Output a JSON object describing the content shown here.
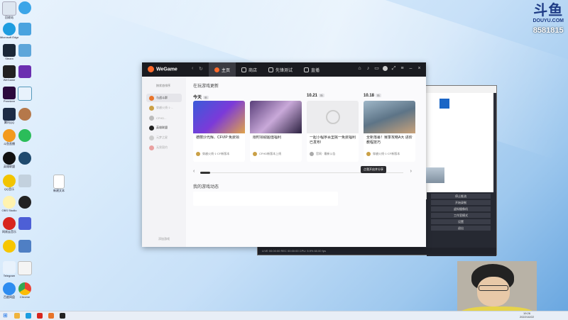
{
  "watermark": {
    "logo": "斗鱼",
    "site": "DOUYU.COM",
    "room": "8581815"
  },
  "app": {
    "brand": "WeGame",
    "tabs": [
      {
        "label": "主页"
      },
      {
        "label": "商店"
      },
      {
        "label": "先锋测试"
      },
      {
        "label": "直播"
      }
    ],
    "sidebar": {
      "sort_label": "按状态排序",
      "items": [
        {
          "label": "与战斗群"
        },
        {
          "label": "穿越火线·1·..."
        },
        {
          "label": "CFHD..."
        },
        {
          "label": "英雄联盟"
        },
        {
          "label": "元梦之星"
        },
        {
          "label": "无畏契约"
        }
      ],
      "footer": "添加游戏"
    },
    "section_title": "在玩游戏更新",
    "cards": [
      {
        "date": "今天",
        "badge": "新",
        "desc": "德丽沙光辉、CFVIP 免费领",
        "meta": "穿越火线·1·CF新版本"
      },
      {
        "date": "",
        "badge": "",
        "desc": "限时领取超值福利",
        "meta": "CFHD新版本上线"
      },
      {
        "date": "10.21",
        "badge": "新",
        "desc": "一起小程序百里挑一免费福利 已发布!",
        "meta": "官网 · 最新公告"
      },
      {
        "date": "10.18",
        "badge": "新",
        "desc": "全新落幕！赛季攻略A大 进阶教程技巧",
        "meta": "穿越火线·1·CF新版本"
      }
    ],
    "tooltip": "点我开启并分享",
    "dynamics_title": "我的游戏动态"
  },
  "obs": {
    "controls": [
      "停止推流",
      "开始录制",
      "虚拟摄像机",
      "工作室模式",
      "设置",
      "退出"
    ],
    "status": "LIVE 00:00:00  REC 00:00:00  CPU: 5.9%  60.00 fps"
  },
  "taskbar": {
    "time": "19:26",
    "date": "2022/10/22"
  },
  "desktop_icons": [
    {
      "label": "回收站"
    },
    {
      "label": "Microsoft Edge"
    },
    {
      "label": "Steam"
    },
    {
      "label": "WeGame"
    },
    {
      "label": "Premiere"
    },
    {
      "label": "腾讯QQ"
    },
    {
      "label": "斗鱼直播"
    },
    {
      "label": "英雄联盟"
    },
    {
      "label": "QQ音乐"
    },
    {
      "label": "OBS Studio"
    },
    {
      "label": "网易云音乐"
    },
    {
      "label": "Chrome"
    },
    {
      "label": "Telegram"
    },
    {
      "label": "百度网盘"
    },
    {
      "label": "新建文本"
    }
  ]
}
